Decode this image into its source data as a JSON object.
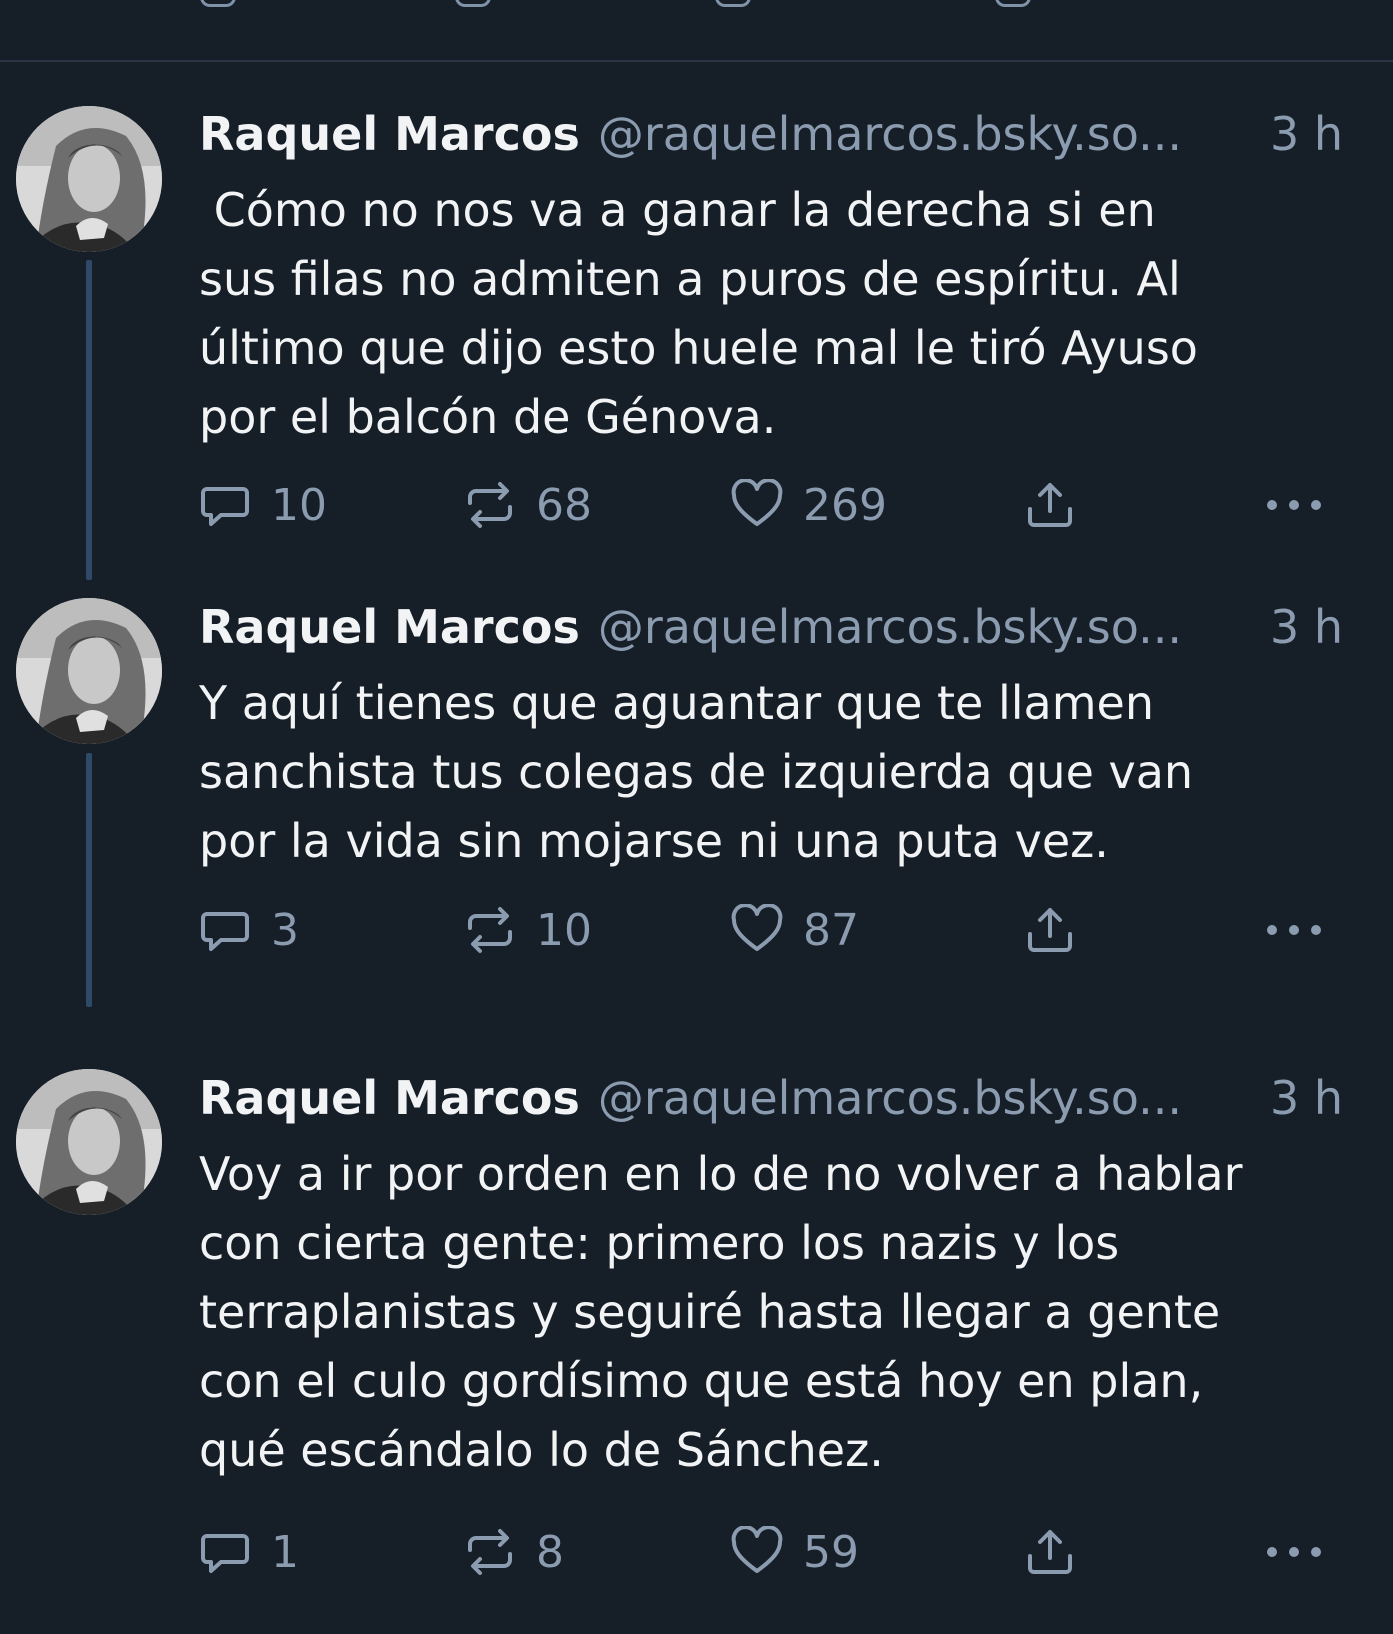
{
  "posts": [
    {
      "author_name": "Raquel Marcos",
      "handle": "@raquelmarcos.bsky.so...",
      "time": "3 h",
      "text": " Cómo no nos va a ganar la derecha si en\nsus filas no admiten a puros de espíritu. Al\núltimo que dijo esto huele mal le tiró Ayuso\npor el balcón de Génova.",
      "replies": "10",
      "reposts": "68",
      "likes": "269"
    },
    {
      "author_name": "Raquel Marcos",
      "handle": "@raquelmarcos.bsky.so...",
      "time": "3 h",
      "text": "Y aquí tienes que aguantar que te llamen\nsanchista tus colegas de izquierda que van\npor la vida sin mojarse ni una puta vez.",
      "replies": "3",
      "reposts": "10",
      "likes": "87"
    },
    {
      "author_name": "Raquel Marcos",
      "handle": "@raquelmarcos.bsky.so...",
      "time": "3 h",
      "text": "Voy a ir por orden en lo de no volver a hablar\ncon cierta gente: primero los nazis y los\nterraplanistas y seguiré hasta llegar a gente\ncon el culo gordísimo que está hoy en plan,\nqué escándalo lo de Sánchez.",
      "replies": "1",
      "reposts": "8",
      "likes": "59"
    }
  ],
  "icons": {
    "reply": "reply-icon",
    "repost": "repost-icon",
    "like": "heart-icon",
    "share": "share-icon",
    "more": "more-icon"
  },
  "colors": {
    "background": "#161e27",
    "text": "#f1f3f5",
    "muted": "#8c9cb0",
    "thread_line": "#2f4a68",
    "divider": "#2b3644"
  }
}
